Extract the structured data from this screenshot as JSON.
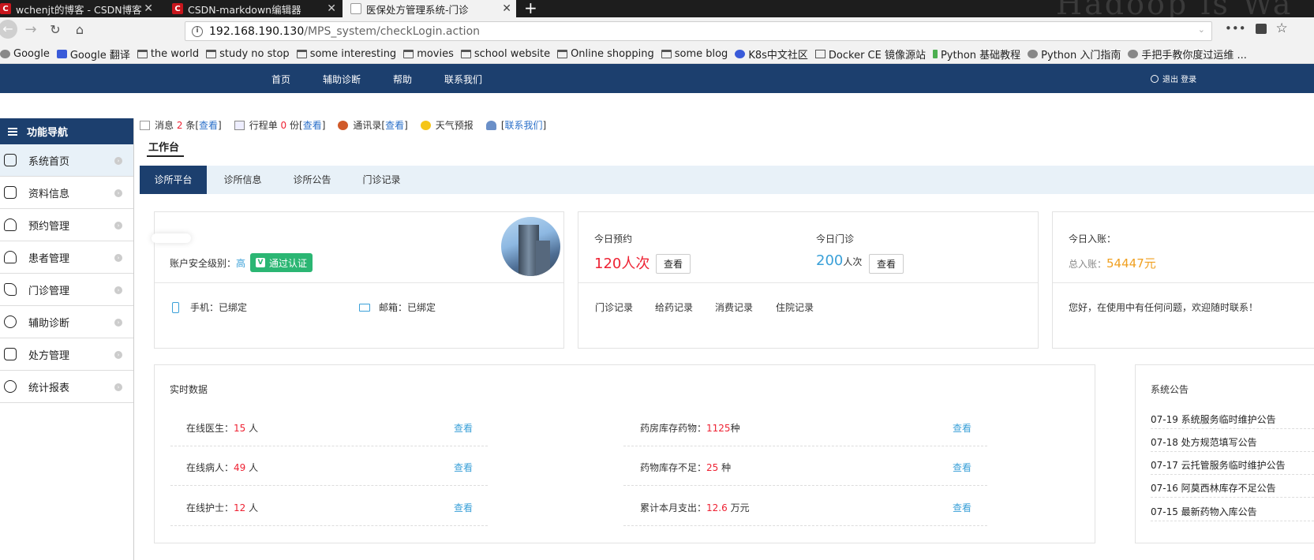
{
  "browser": {
    "tabs": [
      {
        "title": "wchenjt的博客 - CSDN博客",
        "favicon": "csdn-icon",
        "active": false
      },
      {
        "title": "CSDN-markdown编辑器",
        "favicon": "csdn-icon",
        "active": false
      },
      {
        "title": "医保处方管理系统-门诊",
        "favicon": "page-icon",
        "active": true
      }
    ],
    "new_tab": "+",
    "url_host": "192.168.190.130",
    "url_path": "/MPS_system/checkLogin.action",
    "bookmarks": [
      {
        "label": "Google",
        "icon": "globe-icon"
      },
      {
        "label": "Google 翻译",
        "icon": "translate-icon"
      },
      {
        "label": "the world",
        "icon": "folder-icon"
      },
      {
        "label": "study no stop",
        "icon": "folder-icon"
      },
      {
        "label": "some interesting",
        "icon": "folder-icon"
      },
      {
        "label": "movies",
        "icon": "folder-icon"
      },
      {
        "label": "school website",
        "icon": "folder-icon"
      },
      {
        "label": "Online shopping",
        "icon": "folder-icon"
      },
      {
        "label": "some blog",
        "icon": "folder-icon"
      },
      {
        "label": "K8s中文社区",
        "icon": "k8s-icon"
      },
      {
        "label": "Docker CE 镜像源站",
        "icon": "docker-icon"
      },
      {
        "label": "Python 基础教程",
        "icon": "python-icon"
      },
      {
        "label": "Python 入门指南",
        "icon": "globe-icon"
      },
      {
        "label": "手把手教你度过运维 ...",
        "icon": "globe-icon"
      }
    ]
  },
  "topnav": {
    "items": [
      "首页",
      "辅助诊断",
      "帮助",
      "联系我们"
    ],
    "logout": "退出 登录"
  },
  "sidebar": {
    "title": "功能导航",
    "items": [
      {
        "label": "系统首页",
        "icon": "home-icon",
        "active": true
      },
      {
        "label": "资料信息",
        "icon": "document-icon"
      },
      {
        "label": "预约管理",
        "icon": "phone-icon"
      },
      {
        "label": "患者管理",
        "icon": "patient-icon"
      },
      {
        "label": "门诊管理",
        "icon": "stethoscope-icon"
      },
      {
        "label": "辅助诊断",
        "icon": "hand-heart-icon"
      },
      {
        "label": "处方管理",
        "icon": "prescription-icon"
      },
      {
        "label": "统计报表",
        "icon": "clock-icon"
      }
    ]
  },
  "msgbar": {
    "msg_label": "消息",
    "msg_count": "2",
    "msg_unit": "条[",
    "msg_link": "查看",
    "msg_end": "]",
    "trip_label": "行程单",
    "trip_count": "0",
    "trip_unit": "份[",
    "trip_link": "查看",
    "trip_end": "]",
    "contacts_label": "通讯录[",
    "contacts_link": "查看",
    "contacts_end": "]",
    "weather_label": "天气预报",
    "contact_open": "[",
    "contact_link": "联系我们",
    "contact_close": "]"
  },
  "workbench": {
    "title": "工作台",
    "tabs": [
      "诊所平台",
      "诊所信息",
      "诊所公告",
      "门诊记录"
    ]
  },
  "profile": {
    "security_label": "账户安全级别：",
    "security_level": "高",
    "verified": "通过认证",
    "phone": "手机：已绑定",
    "email": "邮箱：已绑定"
  },
  "today": {
    "appt_label": "今日预约",
    "appt_value": "120人次",
    "clinic_label": "今日门诊",
    "clinic_value": "200",
    "clinic_unit": "人次",
    "view": "查看",
    "links": [
      "门诊记录",
      "给药记录",
      "消费记录",
      "住院记录"
    ]
  },
  "income": {
    "today_label": "今日入账：",
    "total_label": "总入账：",
    "total_value": "54447元",
    "message": "您好，在使用中有任何问题，欢迎随时联系！"
  },
  "realtime": {
    "title": "实时数据",
    "left": [
      {
        "label": "在线医生：",
        "value": "15",
        "unit": "人",
        "link": "查看"
      },
      {
        "label": "在线病人：",
        "value": "49",
        "unit": "人",
        "link": "查看"
      },
      {
        "label": "在线护士：",
        "value": "12",
        "unit": "人",
        "link": "查看"
      }
    ],
    "right": [
      {
        "label": "药房库存药物：",
        "value": "1125",
        "unit": "种",
        "link": "查看"
      },
      {
        "label": "药物库存不足：",
        "value": "25",
        "unit": "种",
        "link": "查看"
      },
      {
        "label": "累计本月支出：",
        "value": "12.6",
        "unit": "万元",
        "link": "查看"
      }
    ]
  },
  "announcements": {
    "title": "系统公告",
    "items": [
      "07-19 系统服务临时维护公告",
      "07-18 处方规范填写公告",
      "07-17 云托管服务临时维护公告",
      "07-16 阿莫西林库存不足公告",
      "07-15 最新药物入库公告"
    ]
  }
}
